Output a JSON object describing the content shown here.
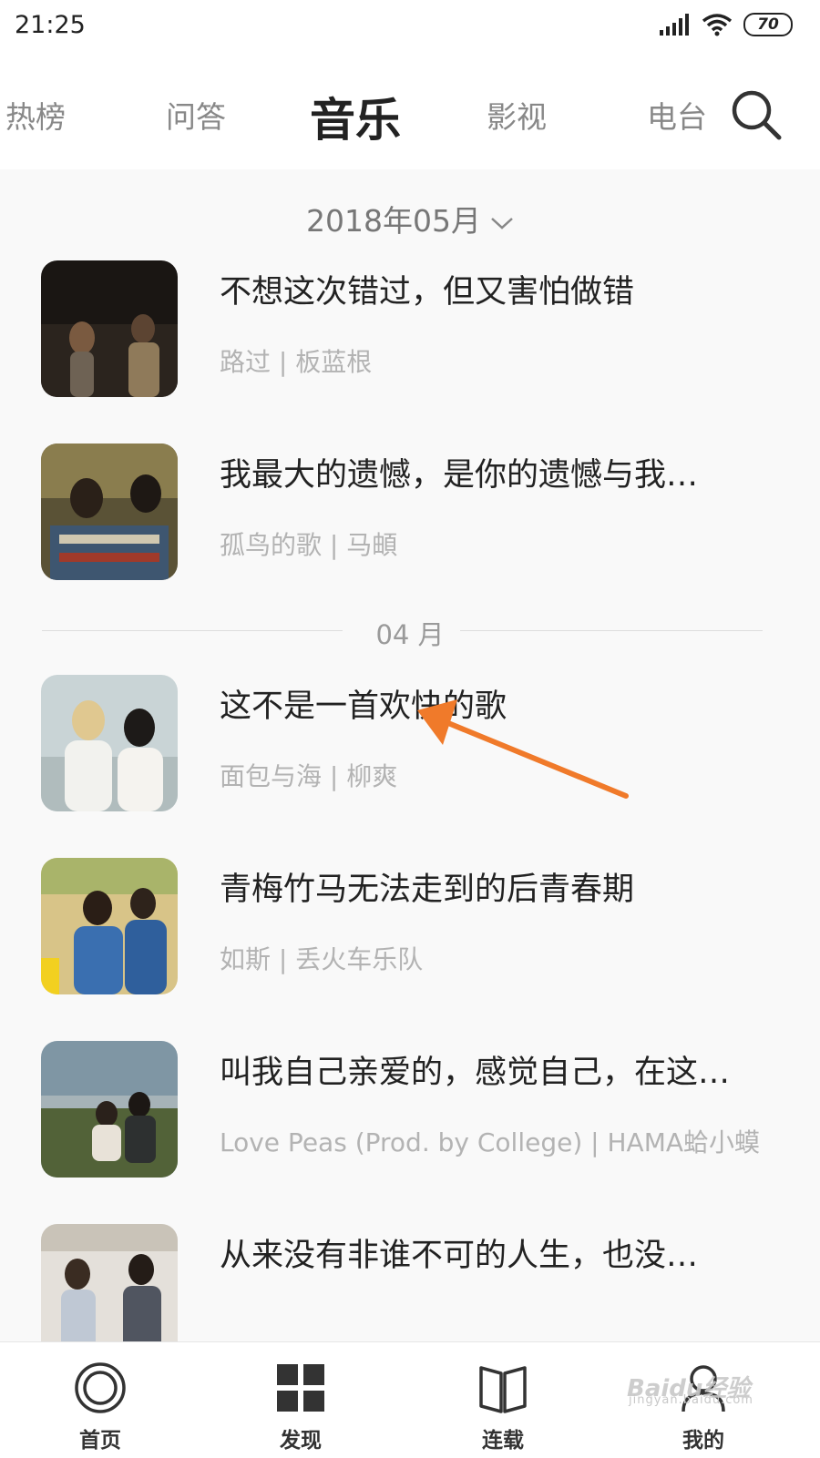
{
  "status_bar": {
    "time": "21:25",
    "battery": "70"
  },
  "top_nav": {
    "tabs": [
      {
        "label": "热榜",
        "active": false
      },
      {
        "label": "问答",
        "active": false
      },
      {
        "label": "音乐",
        "active": true
      },
      {
        "label": "影视",
        "active": false
      },
      {
        "label": "电台",
        "active": false
      }
    ],
    "search_icon": "search-icon"
  },
  "list": {
    "month_selector": "2018年05月",
    "month_divider": "04 月",
    "items": [
      {
        "title": "不想这次错过，但又害怕做错",
        "subtitle": "路过 | 板蓝根"
      },
      {
        "title": "我最大的遗憾，是你的遗憾与我…",
        "subtitle": "孤鸟的歌 | 马頔"
      },
      {
        "title": "这不是一首欢快的歌",
        "subtitle": "面包与海 | 柳爽"
      },
      {
        "title": "青梅竹马无法走到的后青春期",
        "subtitle": "如斯 | 丢火车乐队"
      },
      {
        "title": "叫我自己亲爱的，感觉自己，在这…",
        "subtitle": "Love Peas (Prod. by College) | HAMA蛤小蟆"
      },
      {
        "title": "从来没有非谁不可的人生，也没…",
        "subtitle": ""
      }
    ]
  },
  "bottom_nav": {
    "items": [
      {
        "label": "首页",
        "icon": "home-circle-icon"
      },
      {
        "label": "发现",
        "icon": "grid-icon"
      },
      {
        "label": "连载",
        "icon": "book-icon"
      },
      {
        "label": "我的",
        "icon": "person-icon"
      }
    ]
  },
  "watermark": {
    "logo": "Baidu经验",
    "url": "jingyan.baidu.com"
  },
  "colors": {
    "accent_arrow": "#f07a2a",
    "title_text": "#222222",
    "sub_text": "#b3b3b3",
    "background": "#f9f9f9"
  }
}
